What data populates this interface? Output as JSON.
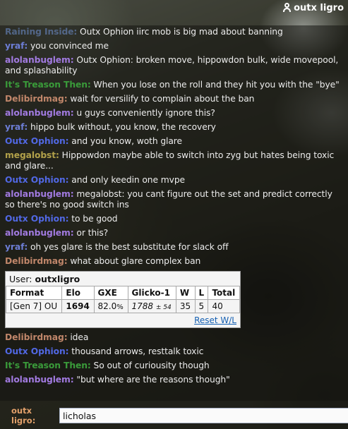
{
  "header": {
    "username": "outx ligro"
  },
  "messages_before": [
    {
      "user": "Raining Inside",
      "color": "#6b8bc8",
      "text": "Outx Ophion iirc mob is big mad about banning",
      "faded": true
    },
    {
      "user": "yraf",
      "color": "#6d7ed6",
      "text": "you convinced me"
    },
    {
      "user": "alolanbuglem",
      "color": "#a17ae0",
      "text": "Outx Ophion: broken move, hippowdon bulk, wide movepool, and splashability"
    },
    {
      "user": "It's Treason Then",
      "color": "#3a9b3a",
      "text": "When you lose on the roll and they hit you with the \"bye\""
    },
    {
      "user": "Delibirdmag",
      "color": "#c0866a",
      "text": "wait for versilify to complain about the ban"
    },
    {
      "user": "alolanbuglem",
      "color": "#a17ae0",
      "text": "u guys conveniently ignore this?"
    },
    {
      "user": "yraf",
      "color": "#6d7ed6",
      "text": "hippo bulk without, you know, the recovery"
    },
    {
      "user": "Outx Ophion",
      "color": "#5168e4",
      "text": "and you know, woth glare"
    },
    {
      "user": "megalobst",
      "color": "#b2a14a",
      "text": "Hippowdon maybe able to switch into zyg but hates being toxic and glare..."
    },
    {
      "user": "Outx Ophion",
      "color": "#5168e4",
      "text": "and only keedin one mvpe"
    },
    {
      "user": "alolanbuglem",
      "color": "#a17ae0",
      "text": "megalobst: you cant figure out the set and predict correctly so there's no good switch ins"
    },
    {
      "user": "Outx Ophion",
      "color": "#5168e4",
      "text": "to be good"
    },
    {
      "user": "alolanbuglem",
      "color": "#a17ae0",
      "text": "or this?"
    },
    {
      "user": "yraf",
      "color": "#6d7ed6",
      "text": "oh yes glare is the best substitute for slack off"
    },
    {
      "user": "Delibirdmag",
      "color": "#c0866a",
      "text": "what about glare complex ban"
    }
  ],
  "rating_card": {
    "user_label": "User:",
    "user_name": "outxligro",
    "headers": [
      "Format",
      "Elo",
      "GXE",
      "Glicko-1",
      "W",
      "L",
      "Total"
    ],
    "row": {
      "format": "[Gen 7] OU",
      "elo": "1694",
      "gxe": "82.0",
      "gxe_unit": "%",
      "glicko": "1788",
      "glicko_dev": "± 54",
      "w": "35",
      "l": "5",
      "total": "40"
    },
    "reset_link": "Reset W/L"
  },
  "messages_after": [
    {
      "user": "Delibirdmag",
      "color": "#c0866a",
      "text": "idea"
    },
    {
      "user": "Outx Ophion",
      "color": "#5168e4",
      "text": "thousand arrows, resttalk toxic"
    },
    {
      "user": "It's Treason Then",
      "color": "#3a9b3a",
      "text": "So out of curiousity though"
    },
    {
      "user": "alolanbuglem",
      "color": "#a17ae0",
      "text": "\"but where are the reasons though\""
    }
  ],
  "input": {
    "label": "outx ligro:",
    "value": "licholas"
  }
}
